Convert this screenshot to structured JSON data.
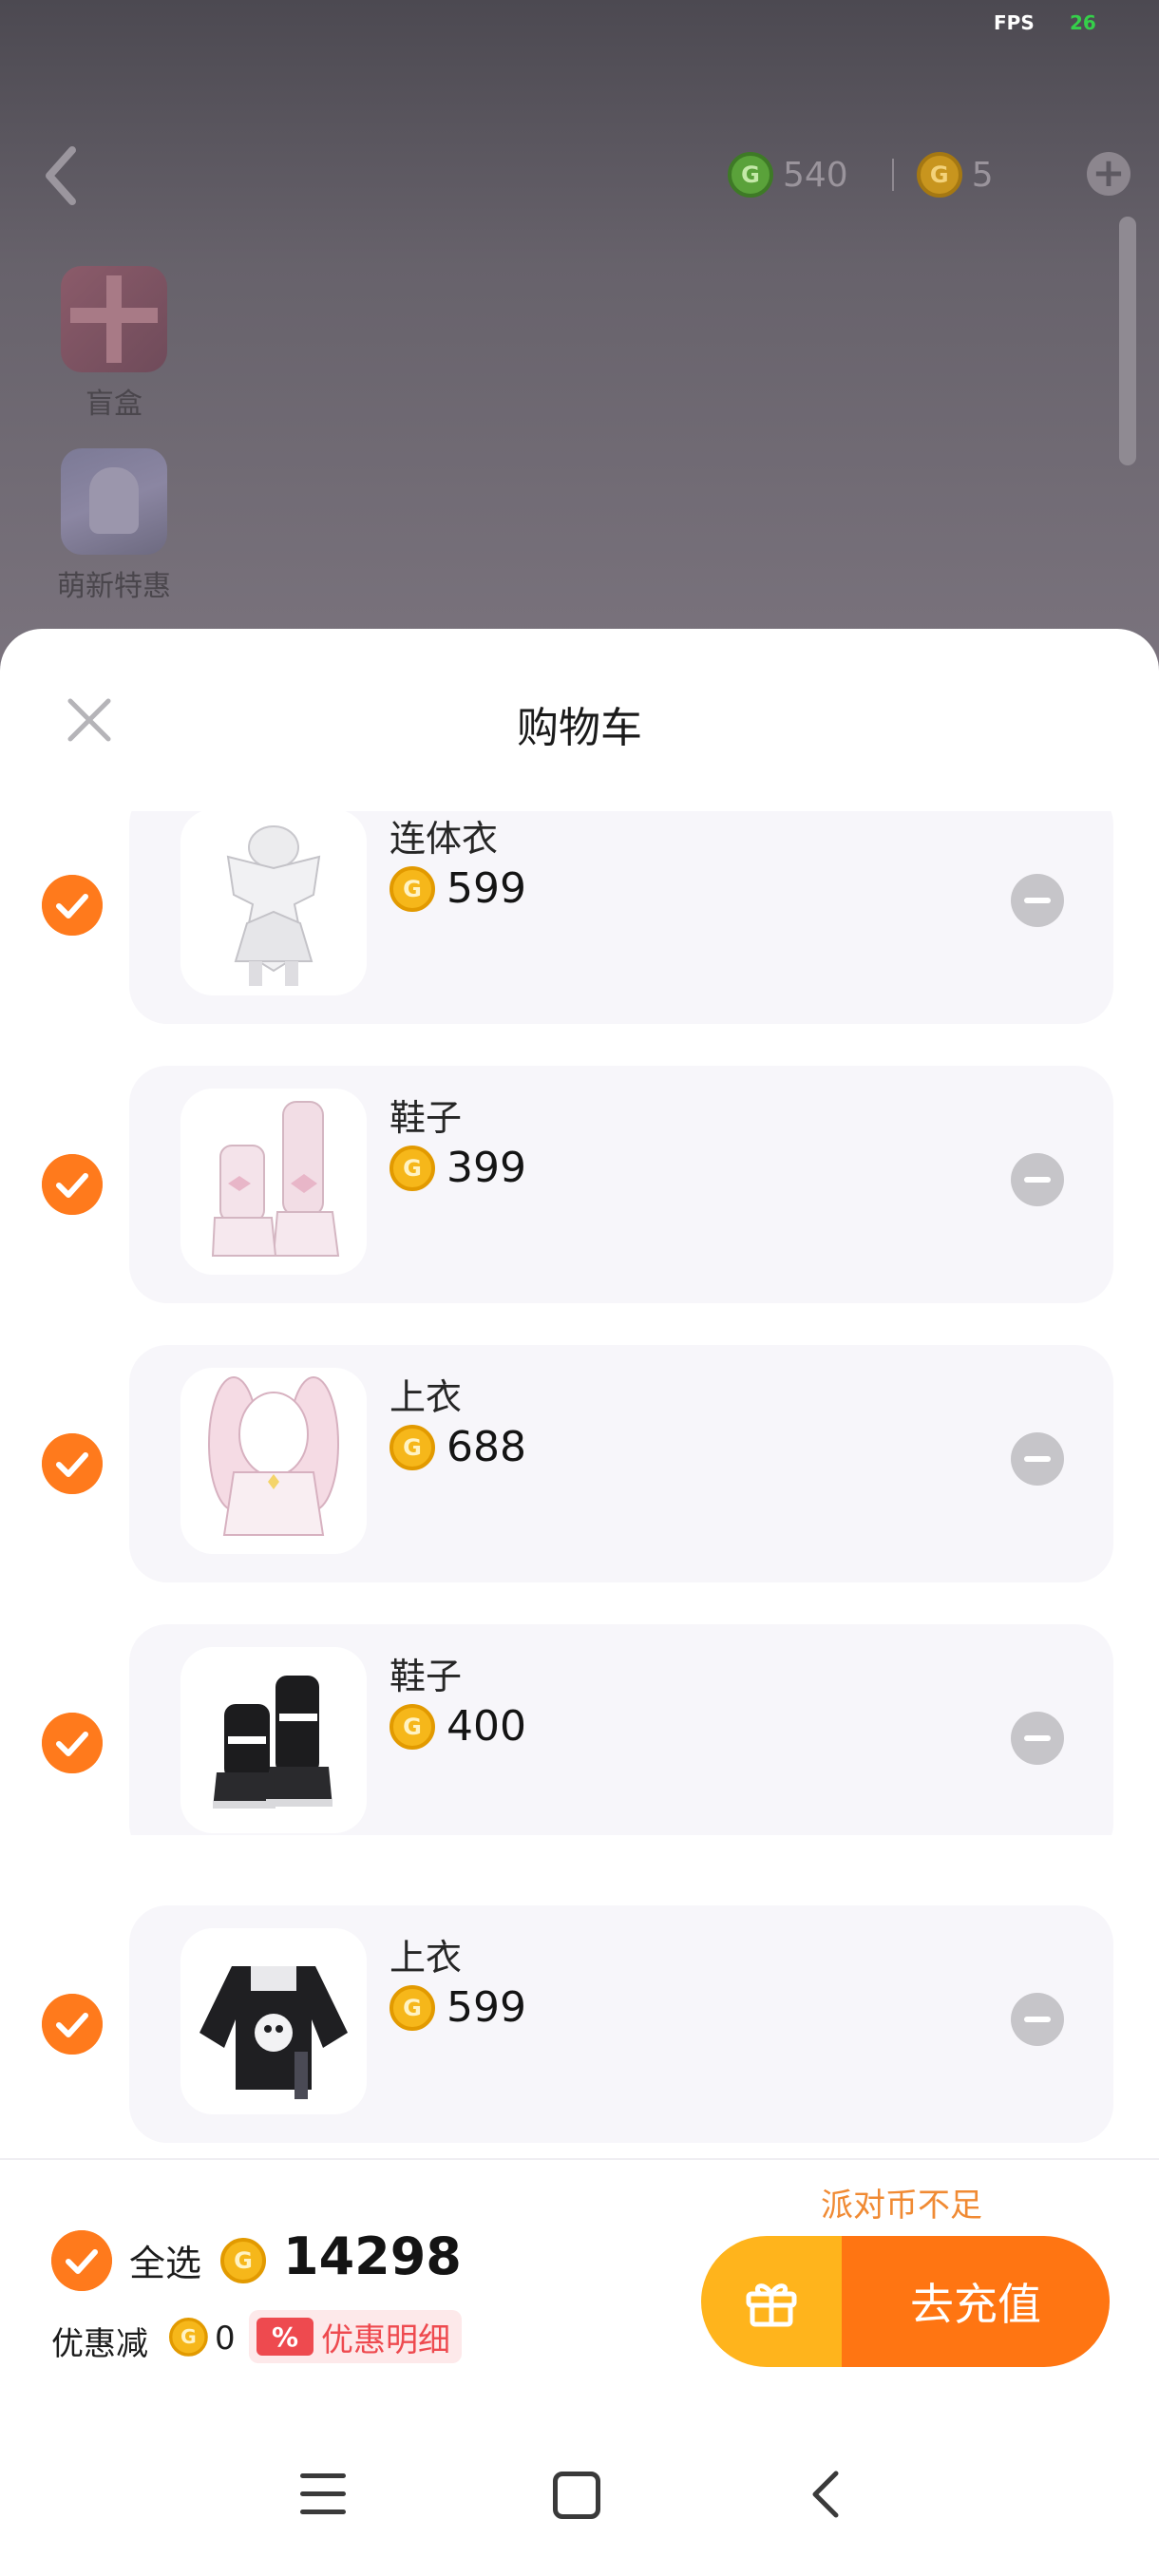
{
  "status": {
    "fps_label": "FPS",
    "fps_value": "26"
  },
  "topbar": {
    "green_coins": "540",
    "gold_coins": "5",
    "coin_glyph": "G"
  },
  "side_menu": [
    {
      "label": "盲盒",
      "icon": "gift-box-icon"
    },
    {
      "label": "萌新特惠",
      "icon": "newbie-promo-icon"
    }
  ],
  "sheet": {
    "title": "购物车",
    "items": [
      {
        "name": "连体衣",
        "price": "599",
        "checked": true
      },
      {
        "name": "鞋子",
        "price": "399",
        "checked": true
      },
      {
        "name": "上衣",
        "price": "688",
        "checked": true
      },
      {
        "name": "鞋子",
        "price": "400",
        "checked": true
      },
      {
        "name": "上衣",
        "price": "599",
        "checked": true
      }
    ]
  },
  "footer": {
    "select_all": "全选",
    "total": "14298",
    "discount_label": "优惠减",
    "discount_value": "0",
    "pct_tag": "%",
    "discount_detail": "优惠明细",
    "insufficient": "派对币不足",
    "recharge": "去充值"
  },
  "colors": {
    "accent": "#ff7a1c",
    "gold": "#f6b71a",
    "recharge": "#ff7512",
    "gift_part": "#ffb41c",
    "discount": "#ee4a4f"
  }
}
